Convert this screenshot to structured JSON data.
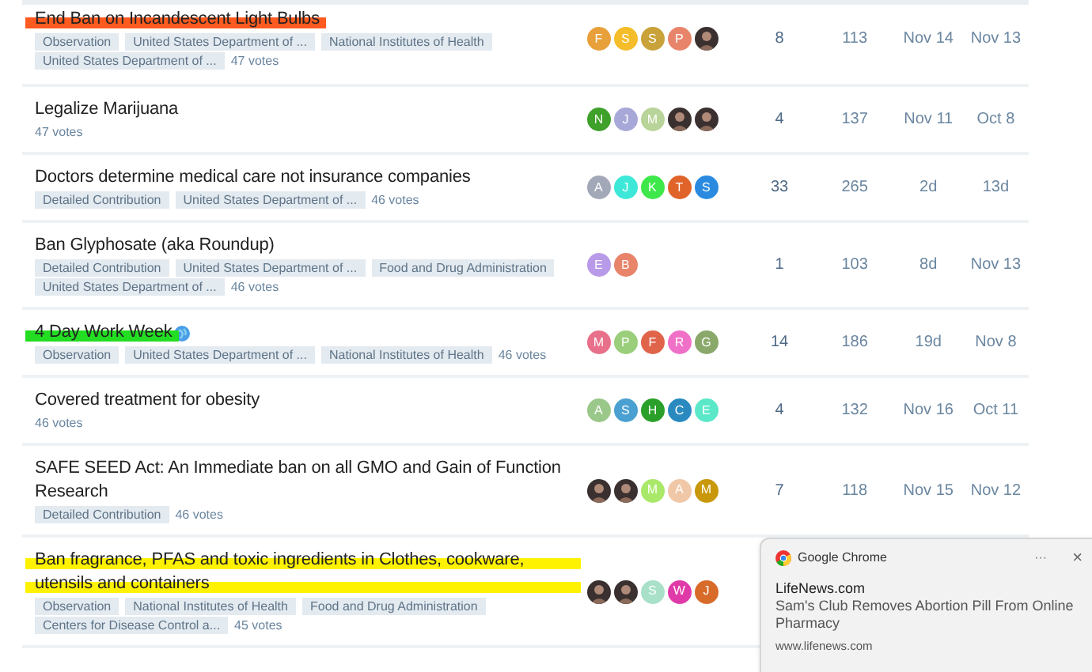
{
  "topics": [
    {
      "title": "End Ban on Incandescent Light Bulbs",
      "color": "#ff5a1f",
      "tags": [
        "Observation",
        "United States Department of ...",
        "National Institutes of Health",
        "United States Department of ..."
      ],
      "votes": "47 votes",
      "posters": [
        {
          "letter": "F",
          "color": "#e8a03a"
        },
        {
          "letter": "S",
          "color": "#f5bd2a"
        },
        {
          "letter": "S",
          "color": "#c9a23a"
        },
        {
          "letter": "P",
          "color": "#e8846a"
        },
        {
          "kind": "photo"
        }
      ],
      "replies": "8",
      "views": "113",
      "activity": "Nov 14",
      "created": "Nov 13"
    },
    {
      "title": "Legalize Marijuana",
      "votes": "47 votes",
      "posters": [
        {
          "letter": "N",
          "color": "#3fa02a"
        },
        {
          "letter": "J",
          "color": "#a8a8d8"
        },
        {
          "letter": "M",
          "color": "#b8d49a"
        },
        {
          "kind": "photo"
        },
        {
          "kind": "photo"
        }
      ],
      "replies": "4",
      "views": "137",
      "activity": "Nov 11",
      "created": "Oct 8"
    },
    {
      "title": "Doctors determine medical care not insurance companies",
      "tags": [
        "Detailed Contribution",
        "United States Department of ..."
      ],
      "votes": "46 votes",
      "posters": [
        {
          "letter": "A",
          "color": "#a3a8b8"
        },
        {
          "letter": "J",
          "color": "#3ee8d8"
        },
        {
          "letter": "K",
          "color": "#3ee84a"
        },
        {
          "letter": "T",
          "color": "#e0642a"
        },
        {
          "letter": "S",
          "color": "#2a8ae0"
        }
      ],
      "replies": "33",
      "views": "265",
      "activity": "2d",
      "created": "13d"
    },
    {
      "title": "Ban Glyphosate (aka Roundup)",
      "tags": [
        "Detailed Contribution",
        "United States Department of ...",
        "Food and Drug Administration",
        "United States Department of ..."
      ],
      "votes": "46 votes",
      "posters": [
        {
          "letter": "E",
          "color": "#b89ae8"
        },
        {
          "letter": "B",
          "color": "#e8846a"
        }
      ],
      "replies": "1",
      "views": "103",
      "activity": "8d",
      "created": "Nov 13"
    },
    {
      "title": "4 Day Work Week",
      "color": "#22dd22",
      "globe": true,
      "tags": [
        "Observation",
        "United States Department of ...",
        "National Institutes of Health"
      ],
      "votes": "46 votes",
      "posters": [
        {
          "letter": "M",
          "color": "#e8708a"
        },
        {
          "letter": "P",
          "color": "#9ace7a"
        },
        {
          "letter": "F",
          "color": "#e0644a"
        },
        {
          "letter": "R",
          "color": "#f070c8"
        },
        {
          "letter": "G",
          "color": "#8aa86a"
        }
      ],
      "replies": "14",
      "views": "186",
      "activity": "19d",
      "created": "Nov 8"
    },
    {
      "title": "Covered treatment for obesity",
      "votes": "46 votes",
      "posters": [
        {
          "letter": "A",
          "color": "#9ac88a"
        },
        {
          "letter": "S",
          "color": "#4aa0d0"
        },
        {
          "letter": "H",
          "color": "#2aa02a"
        },
        {
          "letter": "C",
          "color": "#2a8ac0"
        },
        {
          "letter": "E",
          "color": "#5ae8c8"
        }
      ],
      "replies": "4",
      "views": "132",
      "activity": "Nov 16",
      "created": "Oct 11"
    },
    {
      "title": "SAFE SEED Act: An Immediate ban on all GMO and Gain of Function Research",
      "tags": [
        "Detailed Contribution"
      ],
      "votes": "46 votes",
      "posters": [
        {
          "kind": "photo"
        },
        {
          "kind": "photo"
        },
        {
          "letter": "M",
          "color": "#aae86a"
        },
        {
          "letter": "A",
          "color": "#f0c8a8"
        },
        {
          "letter": "M",
          "color": "#c8980a"
        }
      ],
      "replies": "7",
      "views": "118",
      "activity": "Nov 15",
      "created": "Nov 12"
    },
    {
      "title": "Ban fragrance, PFAS and toxic ingredients in Clothes, cookware, utensils and containers",
      "color": "#fff200",
      "tags": [
        "Observation",
        "National Institutes of Health",
        "Food and Drug Administration",
        "Centers for Disease Control a..."
      ],
      "votes": "45 votes",
      "posters": [
        {
          "kind": "photo"
        },
        {
          "kind": "photo"
        },
        {
          "letter": "S",
          "color": "#a8e0c8"
        },
        {
          "letter": "W",
          "color": "#e03aa8"
        },
        {
          "letter": "J",
          "color": "#d86a2a"
        }
      ]
    }
  ],
  "notification": {
    "app": "Google Chrome",
    "more": "···",
    "close": "×",
    "source": "LifeNews.com",
    "message": "Sam's Club Removes Abortion Pill From Online Pharmacy",
    "url": "www.lifenews.com"
  }
}
